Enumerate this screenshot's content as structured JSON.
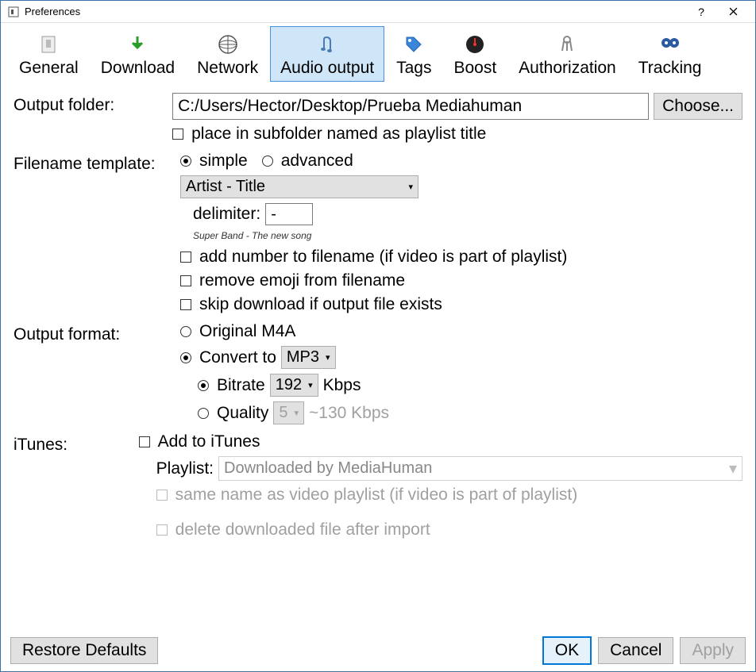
{
  "window": {
    "title": "Preferences"
  },
  "tabs": [
    {
      "label": "General"
    },
    {
      "label": "Download"
    },
    {
      "label": "Network"
    },
    {
      "label": "Audio output"
    },
    {
      "label": "Tags"
    },
    {
      "label": "Boost"
    },
    {
      "label": "Authorization"
    },
    {
      "label": "Tracking"
    }
  ],
  "labels": {
    "output_folder": "Output folder:",
    "filename_template": "Filename template:",
    "output_format": "Output format:",
    "itunes": "iTunes:"
  },
  "output_folder": {
    "value": "C:/Users/Hector/Desktop/Prueba Mediahuman",
    "choose": "Choose...",
    "subfolder": "place in subfolder named as playlist title"
  },
  "filename_template": {
    "simple": "simple",
    "advanced": "advanced",
    "template_value": "Artist - Title",
    "delimiter_label": "delimiter:",
    "delimiter_value": "-",
    "example": "Super Band - The new song",
    "add_number": "add number to filename (if video is part of playlist)",
    "remove_emoji": "remove emoji from filename",
    "skip_download": "skip download if output file exists"
  },
  "output_format": {
    "original": "Original M4A",
    "convert_to": "Convert to",
    "format": "MP3",
    "bitrate_label": "Bitrate",
    "bitrate_value": "192",
    "bitrate_unit": "Kbps",
    "quality_label": "Quality",
    "quality_value": "5",
    "quality_hint": "~130 Kbps"
  },
  "itunes": {
    "add": "Add to iTunes",
    "playlist_label": "Playlist:",
    "playlist_value": "Downloaded by MediaHuman",
    "same_name": "same name as video playlist (if video is part of playlist)",
    "delete_after": "delete downloaded file after import"
  },
  "footer": {
    "restore": "Restore Defaults",
    "ok": "OK",
    "cancel": "Cancel",
    "apply": "Apply"
  }
}
